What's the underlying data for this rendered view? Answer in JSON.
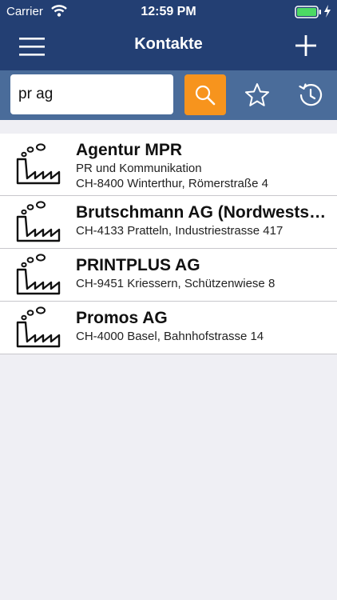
{
  "status": {
    "carrier": "Carrier",
    "time": "12:59 PM"
  },
  "nav": {
    "title": "Kontakte"
  },
  "search": {
    "value": "pr ag"
  },
  "colors": {
    "nav_bg": "#233f73",
    "search_bg": "#4a6c9a",
    "accent": "#f7941d",
    "battery": "#4cd964"
  },
  "contacts": [
    {
      "icon": "factory-icon",
      "name": "Agentur MPR",
      "line1": "PR und Kommunikation",
      "line2": "CH-8400 Winterthur, Römerstraße 4"
    },
    {
      "icon": "factory-icon",
      "name": "Brutschmann AG (Nordwestschweiz)",
      "line1": "CH-4133 Pratteln, Industriestrasse 417"
    },
    {
      "icon": "factory-icon",
      "name": "PRINTPLUS AG",
      "line1": "CH-9451 Kriessern, Schützenwiese 8"
    },
    {
      "icon": "factory-icon",
      "name": "Promos AG",
      "line1": "CH-4000 Basel, Bahnhofstrasse 14"
    }
  ]
}
